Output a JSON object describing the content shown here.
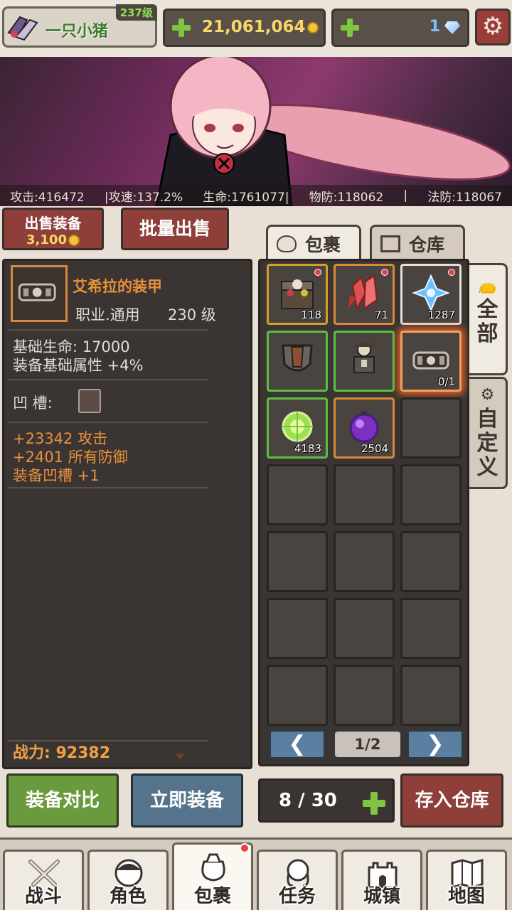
{
  "player": {
    "name": "一只小猪",
    "level": "237级"
  },
  "currency": {
    "gold": "21,061,064",
    "gems": "1"
  },
  "stats": {
    "attack": "攻击:416472",
    "attack_speed": "|攻速:137.2%",
    "hp": "生命:1761077|",
    "phys_def": "物防:118062",
    "separator": "|",
    "magic_def": "法防:118067"
  },
  "sell": {
    "label": "出售装备",
    "price": "3,100",
    "bulk_label": "批量出售"
  },
  "tabs": {
    "bag": "包裹",
    "storage": "仓库"
  },
  "side_tabs": {
    "all": [
      "全",
      "部"
    ],
    "custom": [
      "自",
      "定",
      "义"
    ]
  },
  "item": {
    "name": "艾希拉的装甲",
    "class": "职业.通用",
    "level": "230 级",
    "base_hp": "基础生命:  17000",
    "base_attr": "装备基础属性 +4%",
    "socket_label": "凹    槽:",
    "bonuses": [
      "+23342 攻击",
      "+2401 所有防御",
      "装备凹槽 +1"
    ],
    "power": "战力:  92382"
  },
  "inventory": {
    "slots": [
      {
        "icon": "treasure-chest-icon",
        "count": "118",
        "border": "gold-b",
        "dot": true
      },
      {
        "icon": "red-crystal-icon",
        "count": "71",
        "border": "orange-b",
        "dot": true
      },
      {
        "icon": "blue-crystal-icon",
        "count": "1287",
        "border": "white-b",
        "dot": true
      },
      {
        "icon": "shield-icon",
        "count": "",
        "border": "green-b",
        "dot": false
      },
      {
        "icon": "armor-figure-icon",
        "count": "",
        "border": "green-b",
        "dot": false
      },
      {
        "icon": "armor-icon",
        "count": "0/1",
        "border": "selected",
        "dot": false
      },
      {
        "icon": "green-orb-icon",
        "count": "4183",
        "border": "green-b",
        "dot": false
      },
      {
        "icon": "purple-orb-icon",
        "count": "2504",
        "border": "orange-b",
        "dot": false
      }
    ],
    "total_slots": 21,
    "page": "1/2",
    "prev": "❮",
    "next": "❯"
  },
  "actions": {
    "compare": "装备对比",
    "equip": "立即装备",
    "capacity": "8 / 30",
    "deposit": "存入仓库"
  },
  "nav": [
    {
      "label": "战斗",
      "icon": "swords-icon"
    },
    {
      "label": "角色",
      "icon": "character-icon"
    },
    {
      "label": "包裹",
      "icon": "bag-icon"
    },
    {
      "label": "任务",
      "icon": "quest-icon"
    },
    {
      "label": "城镇",
      "icon": "castle-icon"
    },
    {
      "label": "地图",
      "icon": "map-icon"
    }
  ]
}
